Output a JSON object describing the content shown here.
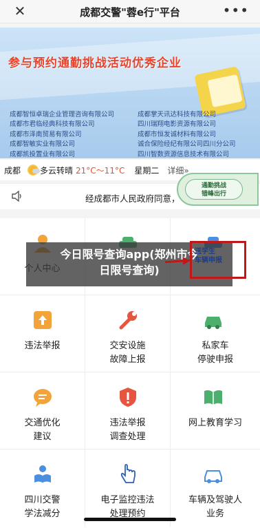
{
  "nav": {
    "close_glyph": "✕",
    "title": "成都交警\"蓉e行\"平台",
    "more_glyph": "•••"
  },
  "banner": {
    "headline": "参与预约通勤挑战活动优秀企业",
    "left_companies": [
      "成都智恒卓瑞企业管理咨询有限公司",
      "成都市君临经典科技有限公司",
      "成都市泽南贸易有限公司",
      "成都智敏实业有限公司",
      "成都凯投置业有限公司"
    ],
    "right_companies": [
      "成都掌天讯达科技有限公司",
      "四川瑞翔电影资源有限公司",
      "成都市恒发诚材料有限公司",
      "诚合保险经纪有限公司四川分公司",
      "四川智数资源信息技术有限公司"
    ],
    "slide_count": 5,
    "active_slide": 2
  },
  "weather": {
    "city": "成都",
    "icon": "partly-cloudy-icon",
    "condition": "多云转晴",
    "temperature": "21°C～11°C",
    "weekday": "星期二",
    "detail_link": "详细»"
  },
  "notice": {
    "icon": "speaker-icon",
    "text": "经成都市人民政府同意，"
  },
  "promo_bubble": {
    "line1": "通勤挑战",
    "line2": "错峰出行"
  },
  "overlay": {
    "line1": "今日限号查询app(郑州市今",
    "line2": "日限号查询)"
  },
  "highlight": {
    "line1": "送学生",
    "line2": "车辆申报"
  },
  "grid": {
    "items": [
      {
        "label": "个人中心",
        "icon": "user-icon"
      },
      {
        "label": "",
        "icon": "car-icon"
      },
      {
        "label": "",
        "icon": "student-car-icon"
      },
      {
        "label": "违法举报",
        "icon": "upload-report-icon"
      },
      {
        "label": "交安设施\n故障上报",
        "icon": "wrench-icon"
      },
      {
        "label": "私家车\n停驶申报",
        "icon": "private-car-icon"
      },
      {
        "label": "交通优化\n建议",
        "icon": "chat-bubble-icon"
      },
      {
        "label": "违法举报\n调查处理",
        "icon": "shield-alert-icon"
      },
      {
        "label": "网上教育学习",
        "icon": "open-book-icon"
      },
      {
        "label": "四川交警\n学法减分",
        "icon": "reading-person-icon"
      },
      {
        "label": "电子监控违法\n处理预约",
        "icon": "hand-pointer-icon"
      },
      {
        "label": "车辆及驾驶人\n业务",
        "icon": "car-driver-icon"
      }
    ]
  },
  "colors": {
    "accent_orange": "#f2a33a",
    "accent_red": "#e5553f",
    "accent_green": "#4caf6e",
    "accent_blue": "#4a8fe0",
    "highlight_red": "#c01818"
  }
}
